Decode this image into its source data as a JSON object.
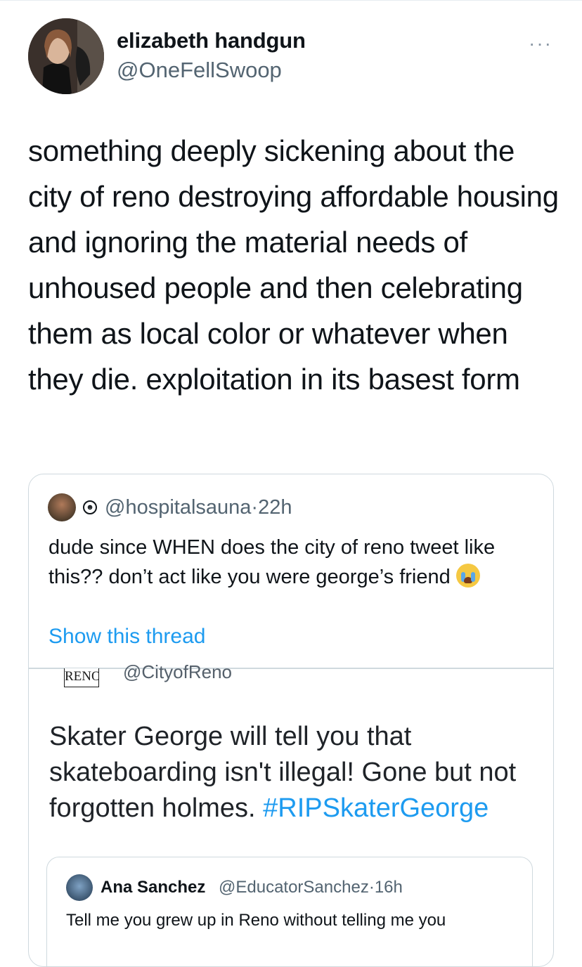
{
  "tweet": {
    "author_name": "elizabeth handgun",
    "author_handle": "@OneFellSwoop",
    "more_menu": "···",
    "text": "something deeply sickening about the city of reno destroying affordable housing and ignoring the material needs of unhoused people and then celebrating them as local color or whatever when they die. exploitation in its basest form"
  },
  "quote": {
    "handle": "@hospitalsauna",
    "separator": "·",
    "time": "22h",
    "text": "dude since WHEN does the city of reno tweet like this?? don’t act like you were george’s friend",
    "emoji": "loudly-crying-face",
    "show_thread": "Show this thread",
    "embedded": {
      "logo_text": "RENO",
      "handle": "@CityofReno",
      "text_prefix": "Skater George will tell you that skateboarding isn't illegal! Gone but not forgotten holmes. ",
      "hashtag": "#RIPSkaterGeorge",
      "inner": {
        "name": "Ana Sanchez",
        "handle": "@EducatorSanchez",
        "separator": "·",
        "time": "16h",
        "text": "Tell me you grew up in Reno without telling me you"
      }
    }
  },
  "colors": {
    "link": "#1d9bf0",
    "secondary_text": "#536471",
    "border": "#cfd9de"
  }
}
